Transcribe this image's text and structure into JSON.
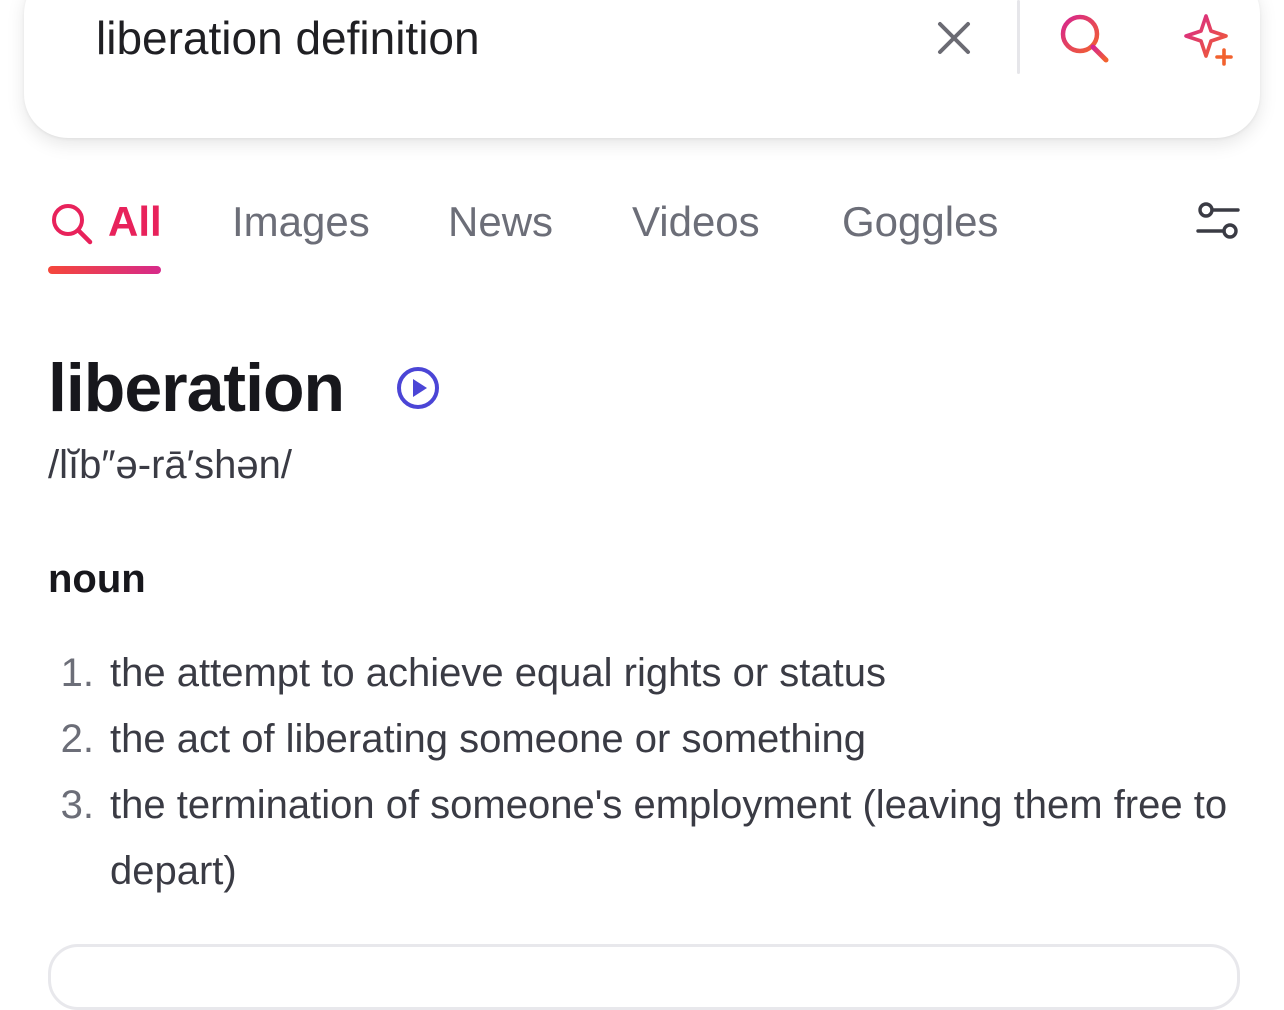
{
  "search": {
    "query": "liberation definition",
    "icons": {
      "clear": "close-icon",
      "search": "search-icon",
      "ai": "sparkle-ai-icon"
    }
  },
  "tabs": [
    {
      "label": "All",
      "active": true,
      "icon": "search-icon"
    },
    {
      "label": "Images"
    },
    {
      "label": "News"
    },
    {
      "label": "Videos"
    },
    {
      "label": "Goggles"
    }
  ],
  "filter_icon": "filter-sliders-icon",
  "dictionary": {
    "word": "liberation",
    "pronunciation": "/lĭb″ə-rā′shən/",
    "part_of_speech": "noun",
    "definitions": [
      {
        "num": "1.",
        "text": "the attempt to achieve equal rights or status"
      },
      {
        "num": "2.",
        "text": "the act of liberating someone or something"
      },
      {
        "num": "3.",
        "text": "the termination of someone's employment (leaving them free to depart)"
      }
    ]
  },
  "colors": {
    "accent_active": "#e8225b",
    "gradient_start": "#f5473a",
    "gradient_end": "#d62a8a",
    "play_icon": "#4b45d6",
    "muted_text": "#6c6e78"
  }
}
